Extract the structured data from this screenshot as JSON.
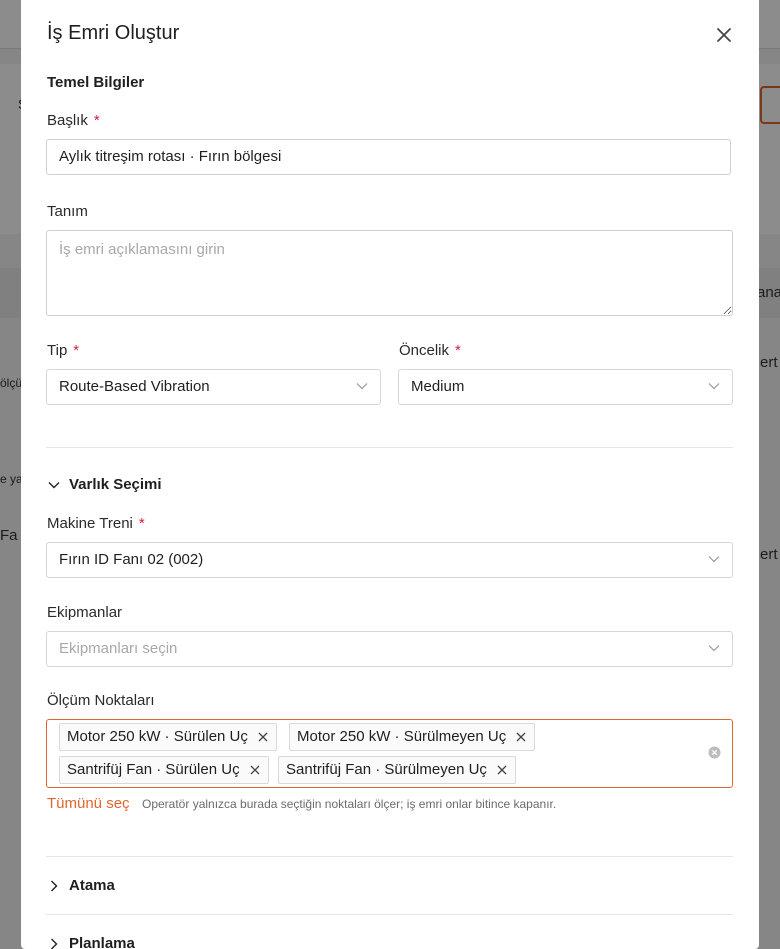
{
  "background": {
    "texts": [
      "S",
      "ölçü",
      "ana",
      "ert k",
      "e ya",
      "Fa",
      "ert k"
    ]
  },
  "modal": {
    "title": "İş Emri Oluştur",
    "basic_section": "Temel Bilgiler",
    "title_field": {
      "label": "Başlık",
      "required": "*",
      "value": "Aylık titreşim rotası · Fırın bölgesi"
    },
    "description_field": {
      "label": "Tanım",
      "placeholder": "İş emri açıklamasını girin"
    },
    "type_field": {
      "label": "Tip",
      "required": "*",
      "value": "Route-Based Vibration"
    },
    "priority_field": {
      "label": "Öncelik",
      "required": "*",
      "value": "Medium"
    },
    "asset_section": "Varlık Seçimi",
    "machine_train_field": {
      "label": "Makine Treni",
      "required": "*",
      "value": "Fırın ID Fanı 02 (002)"
    },
    "equipment_field": {
      "label": "Ekipmanlar",
      "placeholder": "Ekipmanları seçin"
    },
    "measurement_points_field": {
      "label": "Ölçüm Noktaları",
      "tags": [
        "Motor 250 kW · Sürülen Uç",
        "Motor 250 kW · Sürülmeyen Uç",
        "Santrifüj Fan · Sürülen Uç",
        "Santrifüj Fan · Sürülmeyen Uç"
      ],
      "select_all": "Tümünü seç",
      "help": "Operatör yalnızca burada seçtiğin noktaları ölçer; iş emri onlar bitince kapanır."
    },
    "assignment_section": "Atama",
    "planning_section": "Planlama"
  },
  "colors": {
    "accent": "#e0672c",
    "required": "#d4203c"
  }
}
